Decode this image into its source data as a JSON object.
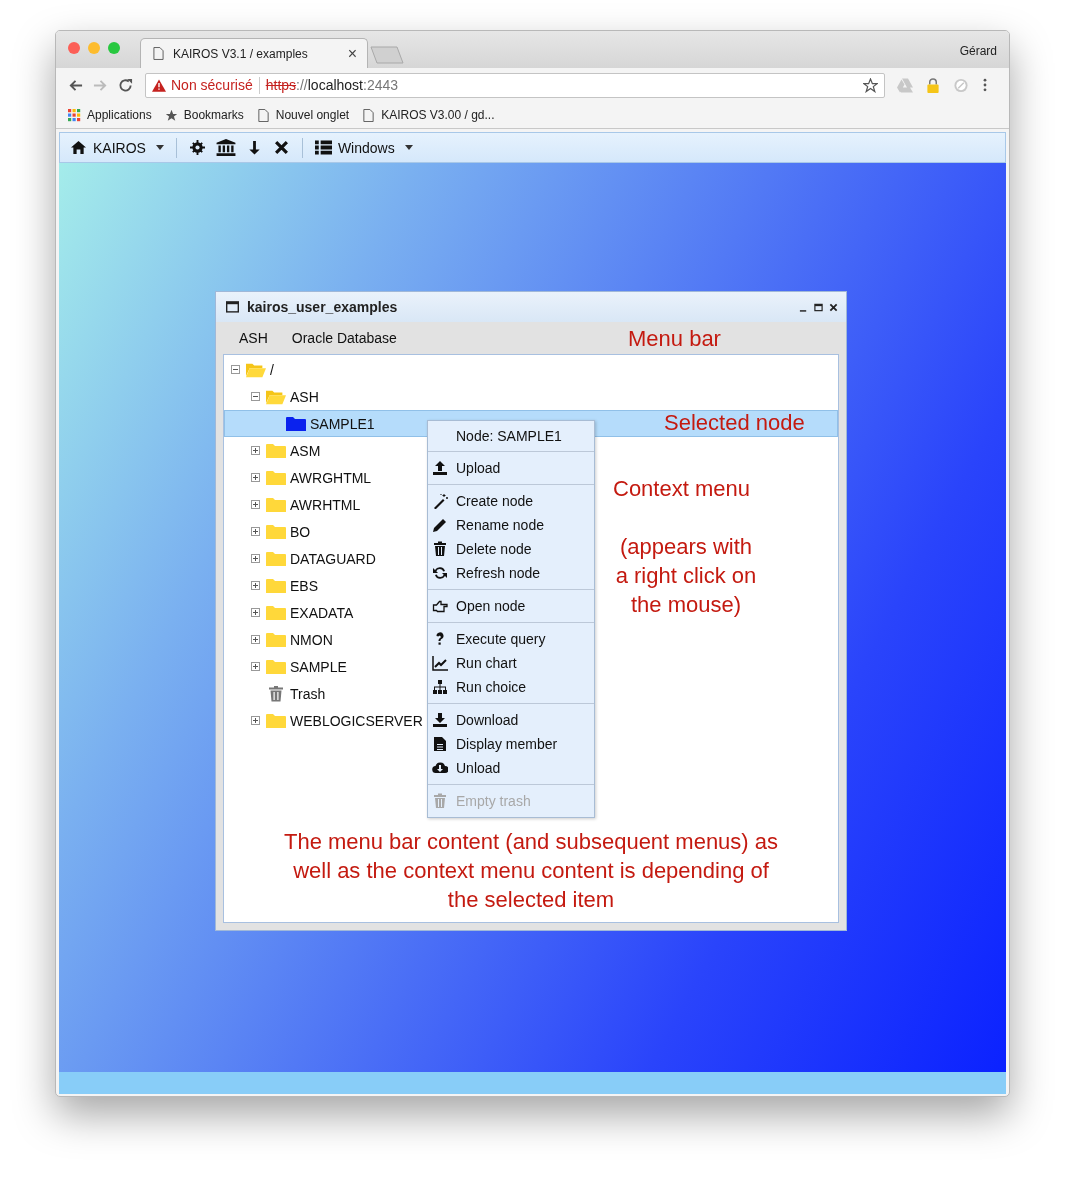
{
  "browser": {
    "tab_title": "KAIROS V3.1 / examples",
    "tab_close": "×",
    "user": "Gérard",
    "address": {
      "security_warning": "Non sécurisé",
      "url_scheme": "https",
      "url_separator": "://",
      "url_host": "localhost",
      "url_port": ":2443"
    },
    "bookmarks": [
      {
        "label": "Applications",
        "kind": "apps"
      },
      {
        "label": "Bookmarks",
        "kind": "star"
      },
      {
        "label": "Nouvel onglet",
        "kind": "page"
      },
      {
        "label": "KAIROS V3.00 / gd...",
        "kind": "page"
      }
    ]
  },
  "app_toolbar": {
    "home_menu": "KAIROS",
    "windows_menu": "Windows"
  },
  "window": {
    "title": "kairos_user_examples",
    "menu_bar": [
      "ASH",
      "Oracle Database"
    ],
    "tree": [
      {
        "label": "/",
        "kind": "folder",
        "expanded": true,
        "selected": false,
        "children": [
          {
            "label": "ASH",
            "kind": "folder",
            "expanded": true,
            "selected": false,
            "children": [
              {
                "label": "SAMPLE1",
                "kind": "folder",
                "selected": true
              }
            ]
          },
          {
            "label": "ASM",
            "kind": "folder",
            "expanded": false,
            "selected": false
          },
          {
            "label": "AWRGHTML",
            "kind": "folder",
            "expanded": false,
            "selected": false
          },
          {
            "label": "AWRHTML",
            "kind": "folder",
            "expanded": false,
            "selected": false
          },
          {
            "label": "BO",
            "kind": "folder",
            "expanded": false,
            "selected": false
          },
          {
            "label": "DATAGUARD",
            "kind": "folder",
            "expanded": false,
            "selected": false
          },
          {
            "label": "EBS",
            "kind": "folder",
            "expanded": false,
            "selected": false
          },
          {
            "label": "EXADATA",
            "kind": "folder",
            "expanded": false,
            "selected": false
          },
          {
            "label": "NMON",
            "kind": "folder",
            "expanded": false,
            "selected": false
          },
          {
            "label": "SAMPLE",
            "kind": "folder",
            "expanded": false,
            "selected": false
          },
          {
            "label": "Trash",
            "kind": "trash",
            "selected": false
          },
          {
            "label": "WEBLOGICSERVER",
            "kind": "folder",
            "expanded": false,
            "selected": false
          }
        ]
      }
    ],
    "context_menu": {
      "header": "Node: SAMPLE1",
      "groups": [
        [
          {
            "label": "Upload",
            "disabled": false
          }
        ],
        [
          {
            "label": "Create node",
            "disabled": false
          },
          {
            "label": "Rename node",
            "disabled": false
          },
          {
            "label": "Delete node",
            "disabled": false
          },
          {
            "label": "Refresh node",
            "disabled": false
          }
        ],
        [
          {
            "label": "Open node",
            "disabled": false
          }
        ],
        [
          {
            "label": "Execute query",
            "disabled": false
          },
          {
            "label": "Run chart",
            "disabled": false
          },
          {
            "label": "Run choice",
            "disabled": false
          }
        ],
        [
          {
            "label": "Download",
            "disabled": false
          },
          {
            "label": "Display member",
            "disabled": false
          },
          {
            "label": "Unload",
            "disabled": false
          }
        ],
        [
          {
            "label": "Empty trash",
            "disabled": true
          }
        ]
      ]
    },
    "annotations": [
      {
        "lines": [
          "Menu bar"
        ]
      },
      {
        "lines": [
          "Selected node"
        ]
      },
      {
        "lines": [
          "Context menu"
        ]
      },
      {
        "lines": [
          "(appears with",
          "a right click on",
          "the mouse)"
        ]
      },
      {
        "lines": [
          "The menu bar content (and subsequent menus) as",
          "well as the context menu content is depending of",
          "the selected item"
        ]
      }
    ]
  }
}
